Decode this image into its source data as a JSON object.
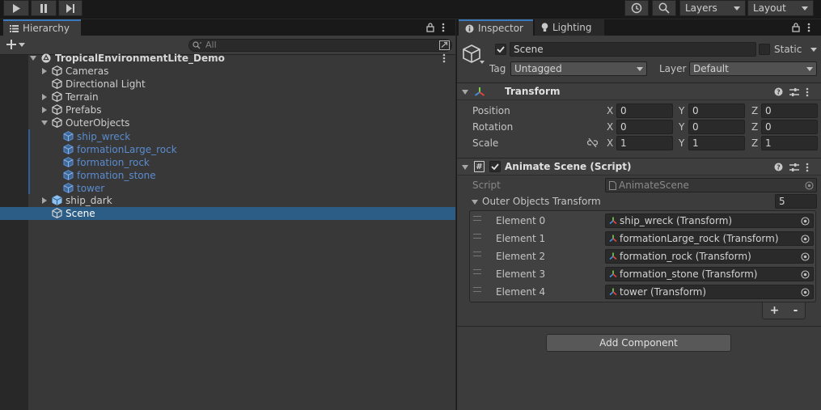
{
  "toolbar": {
    "layers_label": "Layers",
    "layout_label": "Layout"
  },
  "hierarchy": {
    "tab_label": "Hierarchy",
    "search_placeholder": "All",
    "root": "TropicalEnvironmentLite_Demo",
    "items": [
      {
        "label": "Cameras"
      },
      {
        "label": "Directional Light"
      },
      {
        "label": "Terrain"
      },
      {
        "label": "Prefabs"
      },
      {
        "label": "OuterObjects"
      },
      {
        "label": "ship_wreck"
      },
      {
        "label": "formationLarge_rock"
      },
      {
        "label": "formation_rock"
      },
      {
        "label": "formation_stone"
      },
      {
        "label": "tower"
      },
      {
        "label": "ship_dark"
      },
      {
        "label": "Scene"
      }
    ]
  },
  "inspector": {
    "tab_label": "Inspector",
    "lighting_tab_label": "Lighting",
    "object_name": "Scene",
    "static_label": "Static",
    "tag_label": "Tag",
    "tag_value": "Untagged",
    "layer_label": "Layer",
    "layer_value": "Default",
    "transform": {
      "title": "Transform",
      "position_label": "Position",
      "rotation_label": "Rotation",
      "scale_label": "Scale",
      "axis_x": "X",
      "axis_y": "Y",
      "axis_z": "Z",
      "position": {
        "x": "0",
        "y": "0",
        "z": "0"
      },
      "rotation": {
        "x": "0",
        "y": "0",
        "z": "0"
      },
      "scale": {
        "x": "1",
        "y": "1",
        "z": "1"
      }
    },
    "script_component": {
      "title": "Animate Scene (Script)",
      "script_label": "Script",
      "script_value": "AnimateScene",
      "list_label": "Outer Objects Transform",
      "list_size": "5",
      "elements": [
        {
          "label": "Element 0",
          "value": "ship_wreck (Transform)"
        },
        {
          "label": "Element 1",
          "value": "formationLarge_rock (Transform)"
        },
        {
          "label": "Element 2",
          "value": "formation_rock (Transform)"
        },
        {
          "label": "Element 3",
          "value": "formation_stone (Transform)"
        },
        {
          "label": "Element 4",
          "value": "tower (Transform)"
        }
      ],
      "add_label": "+",
      "remove_label": "-"
    },
    "add_component_label": "Add Component"
  },
  "colors": {
    "selection": "#2c5d87",
    "prefab_text": "#5a8ccf",
    "tab_accent": "#3a79bb"
  }
}
